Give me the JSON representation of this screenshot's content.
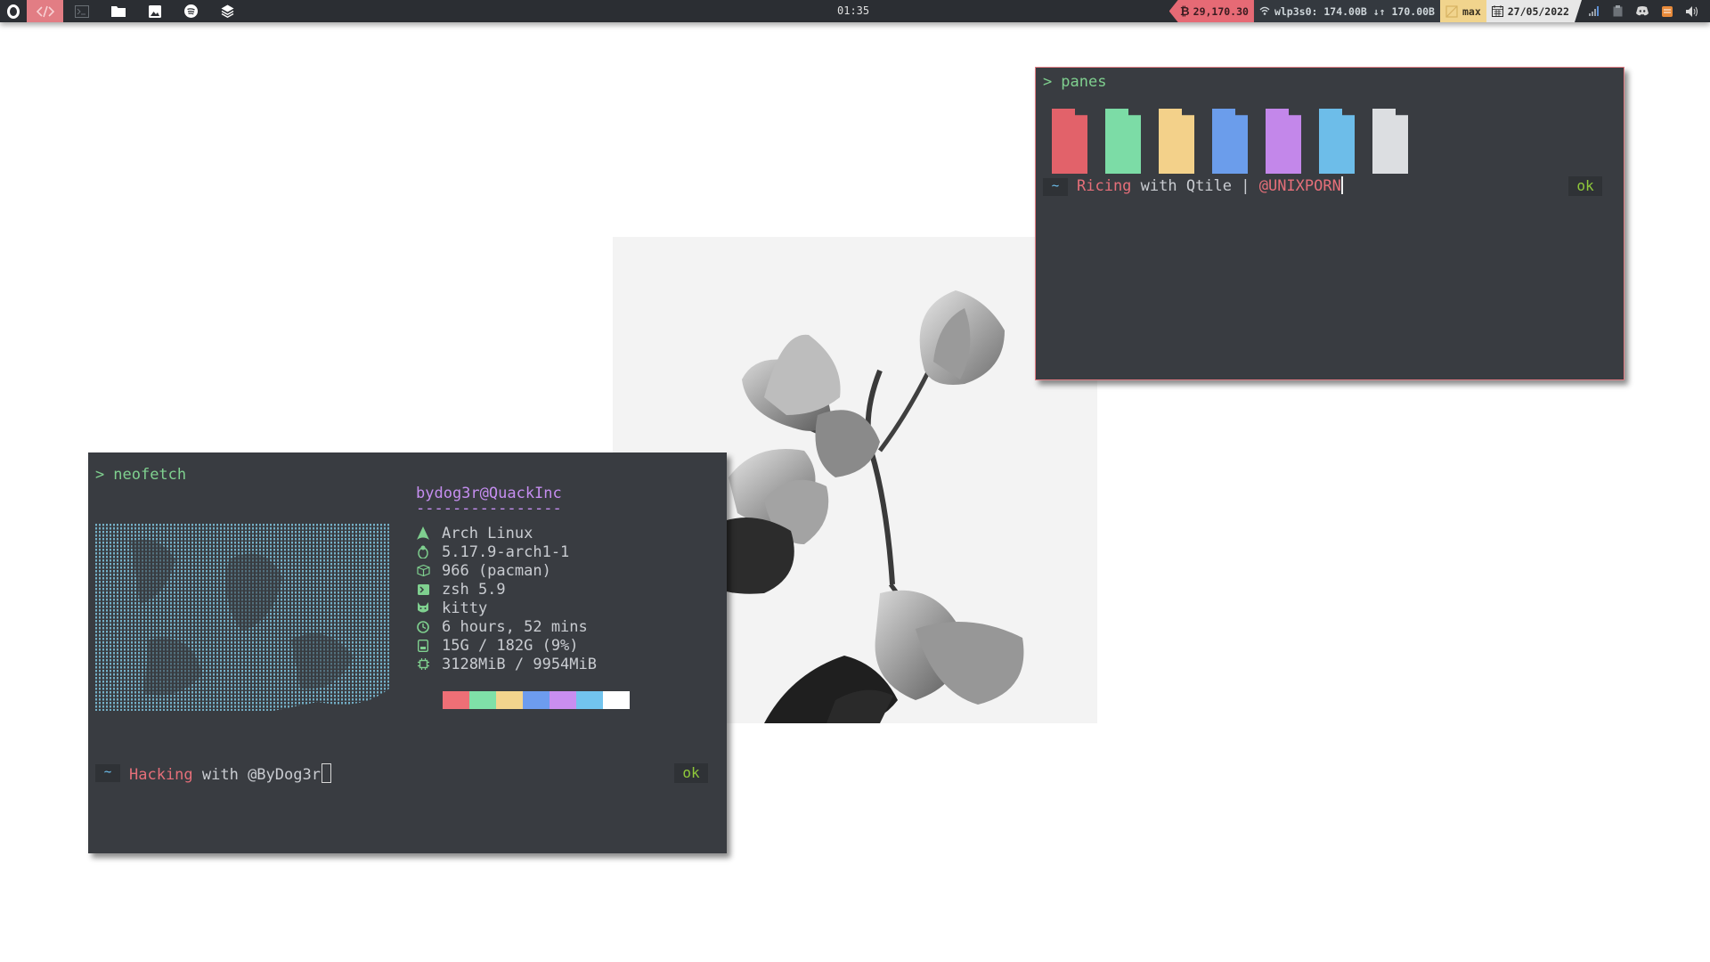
{
  "bar": {
    "clock": "01:35",
    "workspaces": [
      {
        "icon": "code-icon",
        "active": true
      },
      {
        "icon": "terminal-icon",
        "active": false
      },
      {
        "icon": "folder-icon",
        "active": false
      },
      {
        "icon": "image-icon",
        "active": false
      },
      {
        "icon": "spotify-icon",
        "active": false
      },
      {
        "icon": "layers-icon",
        "active": false
      }
    ],
    "btc_price": "29,170.30",
    "network": "wlp3s0: 174.00B ↓↑ 170.00B",
    "brightness": "max",
    "date": "27/05/2022"
  },
  "neofetch": {
    "command": "neofetch",
    "user_host": "bydog3r@QuackInc",
    "separator": "----------------",
    "info": [
      {
        "icon": "arch-icon",
        "value": "Arch Linux"
      },
      {
        "icon": "linux-icon",
        "value": "5.17.9-arch1-1"
      },
      {
        "icon": "package-icon",
        "value": "966 (pacman)"
      },
      {
        "icon": "shell-icon",
        "value": "zsh 5.9"
      },
      {
        "icon": "cat-icon",
        "value": "kitty"
      },
      {
        "icon": "clock-icon",
        "value": "6 hours, 52 mins"
      },
      {
        "icon": "disk-icon",
        "value": "15G / 182G (9%)"
      },
      {
        "icon": "memory-icon",
        "value": "3128MiB / 9954MiB"
      }
    ],
    "palette": [
      "#393c41",
      "#ee6f76",
      "#7fe0a8",
      "#f3d48d",
      "#6d9cef",
      "#c98ef0",
      "#72c4ee",
      "#ffffff"
    ],
    "prompt_tilde": "~",
    "prompt_word": "Hacking",
    "prompt_rest": " with @ByDog3r",
    "status": "ok"
  },
  "panes": {
    "command": "panes",
    "swatches": [
      "#e2626a",
      "#7cdca6",
      "#f3d18a",
      "#6b9deb",
      "#c387ea",
      "#6dbde9",
      "#dcdee1"
    ],
    "prompt_tilde": "~",
    "prompt_word": "Ricing",
    "prompt_mid": " with Qtile | ",
    "prompt_handle": "@UNIXPORN",
    "status": "ok"
  },
  "colors": {
    "terminal_bg": "#393c41",
    "accent_red": "#e56f79",
    "accent_green": "#7fd08f",
    "accent_purple": "#c58ef0",
    "bar_bg": "#2b2e33"
  }
}
